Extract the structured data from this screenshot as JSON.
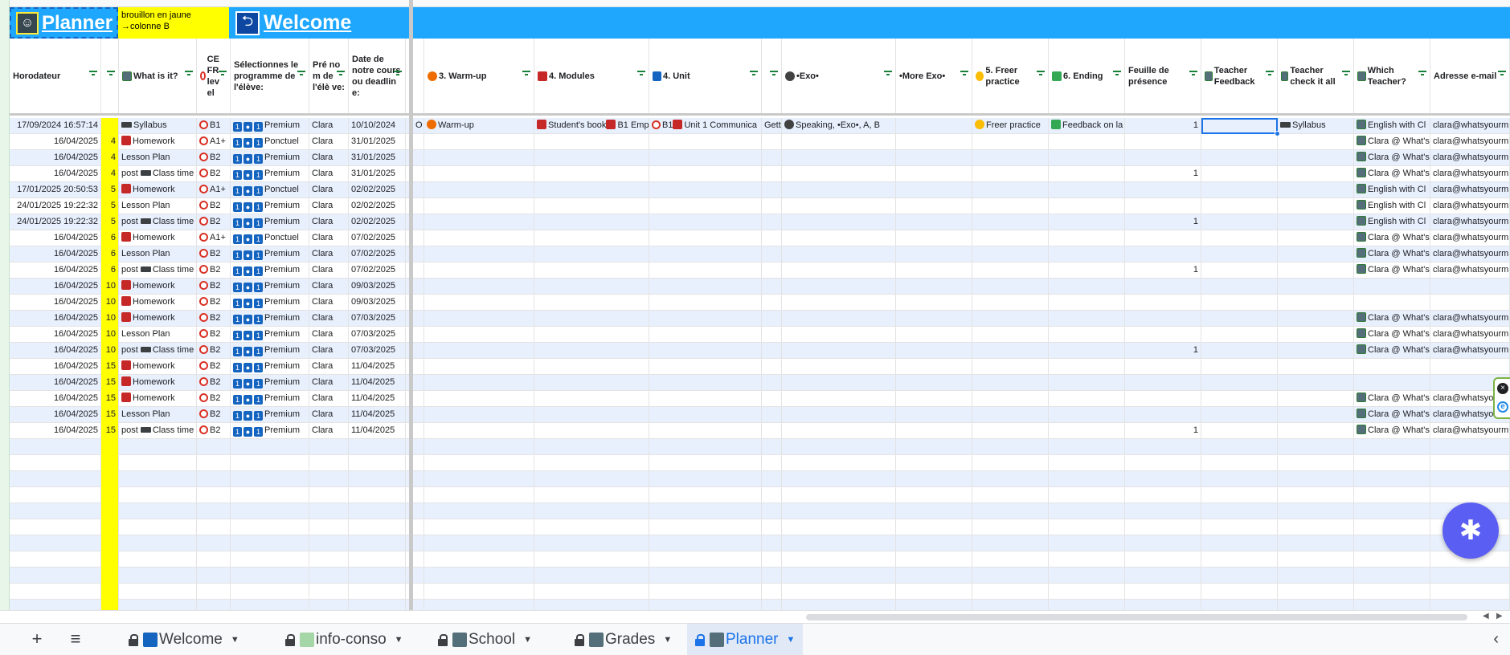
{
  "banner": {
    "planner_label": "Planner",
    "note_line1": "brouillon en jaune",
    "note_line2": "→colonne B",
    "welcome_label": "Welcome"
  },
  "headers": [
    "Horodateur",
    "",
    "What is it?",
    "CE FR lev el",
    "Sélectionnes le programme de l'élève:",
    "Pré no m de l'élè ve:",
    "Date de notre cours ou deadlin e:",
    "",
    "3. Warm-up",
    "4. Modules",
    "4. Unit",
    "",
    "•Exo•",
    "•More Exo•",
    "5. Freer practice",
    "6. Ending",
    "Feuille de présence",
    "Teacher Feedback",
    "Teacher check it all",
    "Which Teacher?",
    "Adresse e-mail"
  ],
  "rows": [
    {
      "ts": "17/09/2024 16:57:14",
      "b": "",
      "what": "Syllabus",
      "ce": "B1",
      "prog": "Premium",
      "name": "Clara",
      "date": "10/10/2024",
      "o": "O",
      "warm": "Warm-up",
      "mod": "Student's book",
      "mod2": "B1 Emp",
      "unit": "B1",
      "unit2": "Unit 1 Communica",
      "g": "Gett",
      "exo": "Speaking, •Exo•, A, B",
      "more": "",
      "freer": "Freer practice",
      "ending": "Feedback on la",
      "pres": "1",
      "fb": "",
      "check": "Syllabus",
      "teacher": "English with Cl",
      "email": "clara@whatsyourm"
    },
    {
      "ts": "16/04/2025",
      "b": "4",
      "what": "Homework",
      "ce": "A1+",
      "prog": "Ponctuel",
      "name": "Clara",
      "date": "31/01/2025",
      "pres": "",
      "check": "",
      "teacher": "Clara @ What's",
      "email": "clara@whatsyourm"
    },
    {
      "ts": "16/04/2025",
      "b": "4",
      "what": "Lesson Plan",
      "ce": "B2",
      "prog": "Premium",
      "name": "Clara",
      "date": "31/01/2025",
      "pres": "",
      "check": "",
      "teacher": "Clara @ What's",
      "email": "clara@whatsyourm"
    },
    {
      "ts": "16/04/2025",
      "b": "4",
      "what": "post Class time",
      "ce": "B2",
      "prog": "Premium",
      "name": "Clara",
      "date": "31/01/2025",
      "pres": "1",
      "check": "",
      "teacher": "Clara @ What's",
      "email": "clara@whatsyourm"
    },
    {
      "ts": "17/01/2025 20:50:53",
      "b": "5",
      "what": "Homework",
      "ce": "A1+",
      "prog": "Ponctuel",
      "name": "Clara",
      "date": "02/02/2025",
      "pres": "",
      "check": "",
      "teacher": "English with Cl",
      "email": "clara@whatsyourm"
    },
    {
      "ts": "24/01/2025 19:22:32",
      "b": "5",
      "what": "Lesson Plan",
      "ce": "B2",
      "prog": "Premium",
      "name": "Clara",
      "date": "02/02/2025",
      "pres": "",
      "check": "",
      "teacher": "English with Cl",
      "email": "clara@whatsyourm"
    },
    {
      "ts": "24/01/2025 19:22:32",
      "b": "5",
      "what": "post Class time",
      "ce": "B2",
      "prog": "Premium",
      "name": "Clara",
      "date": "02/02/2025",
      "pres": "1",
      "check": "",
      "teacher": "English with Cl",
      "email": "clara@whatsyourm"
    },
    {
      "ts": "16/04/2025",
      "b": "6",
      "what": "Homework",
      "ce": "A1+",
      "prog": "Ponctuel",
      "name": "Clara",
      "date": "07/02/2025",
      "pres": "",
      "check": "",
      "teacher": "Clara @ What's",
      "email": "clara@whatsyourm"
    },
    {
      "ts": "16/04/2025",
      "b": "6",
      "what": "Lesson Plan",
      "ce": "B2",
      "prog": "Premium",
      "name": "Clara",
      "date": "07/02/2025",
      "pres": "",
      "check": "",
      "teacher": "Clara @ What's",
      "email": "clara@whatsyourm"
    },
    {
      "ts": "16/04/2025",
      "b": "6",
      "what": "post Class time",
      "ce": "B2",
      "prog": "Premium",
      "name": "Clara",
      "date": "07/02/2025",
      "pres": "1",
      "check": "",
      "teacher": "Clara @ What's",
      "email": "clara@whatsyourm"
    },
    {
      "ts": "16/04/2025",
      "b": "10",
      "what": "Homework",
      "ce": "B2",
      "prog": "Premium",
      "name": "Clara",
      "date": "09/03/2025",
      "pres": "",
      "check": "",
      "teacher": "",
      "email": ""
    },
    {
      "ts": "16/04/2025",
      "b": "10",
      "what": "Homework",
      "ce": "B2",
      "prog": "Premium",
      "name": "Clara",
      "date": "09/03/2025",
      "pres": "",
      "check": "",
      "teacher": "",
      "email": ""
    },
    {
      "ts": "16/04/2025",
      "b": "10",
      "what": "Homework",
      "ce": "B2",
      "prog": "Premium",
      "name": "Clara",
      "date": "07/03/2025",
      "pres": "",
      "check": "",
      "teacher": "Clara @ What's",
      "email": "clara@whatsyourm"
    },
    {
      "ts": "16/04/2025",
      "b": "10",
      "what": "Lesson Plan",
      "ce": "B2",
      "prog": "Premium",
      "name": "Clara",
      "date": "07/03/2025",
      "pres": "",
      "check": "",
      "teacher": "Clara @ What's",
      "email": "clara@whatsyourm"
    },
    {
      "ts": "16/04/2025",
      "b": "10",
      "what": "post Class time",
      "ce": "B2",
      "prog": "Premium",
      "name": "Clara",
      "date": "07/03/2025",
      "pres": "1",
      "check": "",
      "teacher": "Clara @ What's",
      "email": "clara@whatsyourm"
    },
    {
      "ts": "16/04/2025",
      "b": "15",
      "what": "Homework",
      "ce": "B2",
      "prog": "Premium",
      "name": "Clara",
      "date": "11/04/2025",
      "pres": "",
      "check": "",
      "teacher": "",
      "email": ""
    },
    {
      "ts": "16/04/2025",
      "b": "15",
      "what": "Homework",
      "ce": "B2",
      "prog": "Premium",
      "name": "Clara",
      "date": "11/04/2025",
      "pres": "",
      "check": "",
      "teacher": "",
      "email": ""
    },
    {
      "ts": "16/04/2025",
      "b": "15",
      "what": "Homework",
      "ce": "B2",
      "prog": "Premium",
      "name": "Clara",
      "date": "11/04/2025",
      "pres": "",
      "check": "",
      "teacher": "Clara @ What's",
      "email": "clara@whatsyourm"
    },
    {
      "ts": "16/04/2025",
      "b": "15",
      "what": "Lesson Plan",
      "ce": "B2",
      "prog": "Premium",
      "name": "Clara",
      "date": "11/04/2025",
      "pres": "",
      "check": "",
      "teacher": "Clara @ What's",
      "email": "clara@whatsyourm"
    },
    {
      "ts": "16/04/2025",
      "b": "15",
      "what": "post Class time",
      "ce": "B2",
      "prog": "Premium",
      "name": "Clara",
      "date": "11/04/2025",
      "pres": "1",
      "check": "",
      "teacher": "Clara @ What's",
      "email": "clara@whatsyourm"
    }
  ],
  "empty_rows": 11,
  "prog_badges": [
    "1",
    "●",
    "1"
  ],
  "fab_icon": "✱",
  "side_widget": {
    "top": "×",
    "bottom": "e"
  },
  "tabs": [
    {
      "label": "Welcome",
      "icon": "welcome-icon",
      "active": false
    },
    {
      "label": "info-conso",
      "icon": "info-conso-icon",
      "active": false
    },
    {
      "label": "School",
      "icon": "teacher-icon",
      "active": false
    },
    {
      "label": "Grades",
      "icon": "teacher-icon",
      "active": false
    },
    {
      "label": "Planner",
      "icon": "teacher-icon",
      "active": true
    }
  ],
  "tabbar": {
    "add": "+",
    "menu": "≡",
    "nav": "‹"
  },
  "colors": {
    "banner": "#1ea7fd",
    "yellow": "#ffff00",
    "row_alt": "#e8f0fe",
    "active_tab": "#1a73e8",
    "fab": "#5b5ef2"
  }
}
